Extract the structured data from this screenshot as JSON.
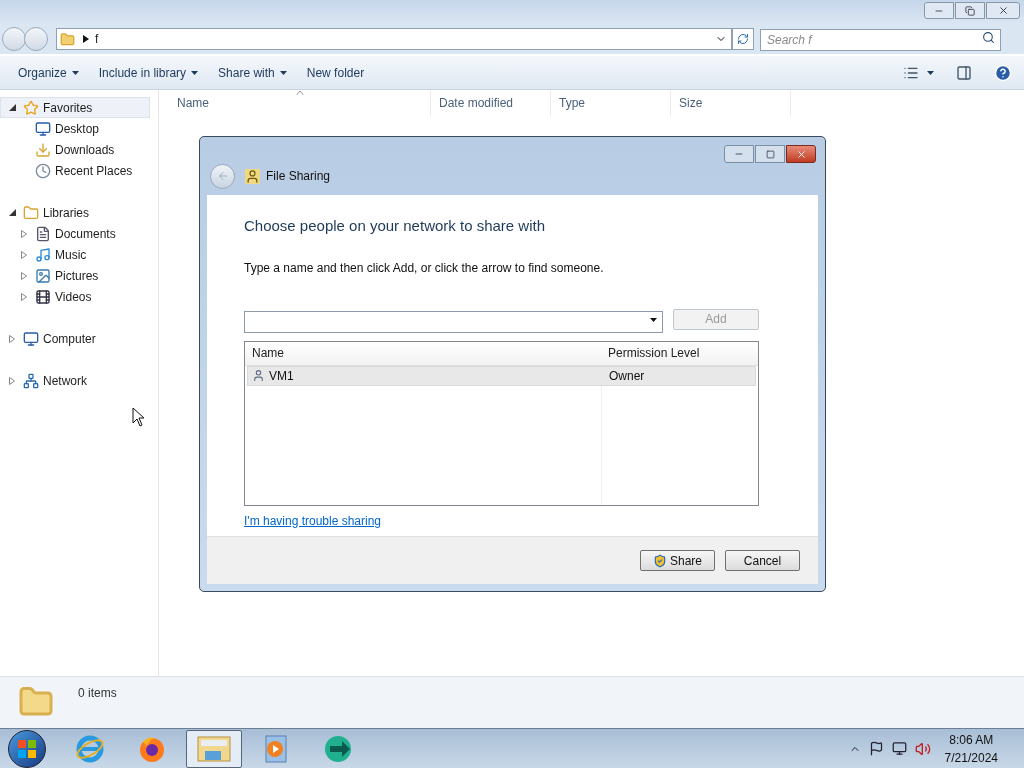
{
  "explorer": {
    "address": {
      "path": "f"
    },
    "search": {
      "placeholder": "Search f"
    },
    "toolbar": [
      {
        "label": "Organize",
        "has_menu": true
      },
      {
        "label": "Include in library",
        "has_menu": true
      },
      {
        "label": "Share with",
        "has_menu": true
      },
      {
        "label": "New folder",
        "has_menu": false
      }
    ],
    "sidebar": [
      {
        "label": "Favorites",
        "expanded": true,
        "selected": true,
        "children": [
          {
            "label": "Desktop",
            "selected": false
          },
          {
            "label": "Downloads",
            "selected": false
          },
          {
            "label": "Recent Places",
            "selected": false
          }
        ]
      },
      {
        "label": "Libraries",
        "expanded": true,
        "selected": false,
        "children": [
          {
            "label": "Documents",
            "expanded": false,
            "selected": false
          },
          {
            "label": "Music",
            "expanded": false,
            "selected": false
          },
          {
            "label": "Pictures",
            "expanded": false,
            "selected": false
          },
          {
            "label": "Videos",
            "expanded": false,
            "selected": false
          }
        ]
      },
      {
        "label": "Computer",
        "expanded": false,
        "selected": false
      },
      {
        "label": "Network",
        "expanded": false,
        "selected": false
      }
    ],
    "columns": [
      {
        "label": "Name",
        "sorted": true
      },
      {
        "label": "Date modified",
        "sorted": false
      },
      {
        "label": "Type",
        "sorted": false
      },
      {
        "label": "Size",
        "sorted": false
      }
    ],
    "status": {
      "count": "0 items"
    }
  },
  "dialog": {
    "title": "File Sharing",
    "heading": "Choose people on your network to share with",
    "instruction": "Type a name and then click Add, or click the arrow to find someone.",
    "add_button": {
      "label": "Add",
      "disabled": true
    },
    "columns": [
      "Name",
      "Permission Level"
    ],
    "rows": [
      {
        "name": "VM1",
        "permission": "Owner",
        "selected": true
      }
    ],
    "link": "I'm having trouble sharing",
    "buttons": [
      {
        "label": "Share",
        "kind": "shield"
      },
      {
        "label": "Cancel",
        "kind": "plain"
      }
    ]
  },
  "taskbar": {
    "apps": [
      {
        "selected": false
      },
      {
        "selected": false
      },
      {
        "selected": true
      },
      {
        "selected": false
      },
      {
        "selected": false
      }
    ],
    "time": "8:06 AM",
    "date": "7/21/2024"
  }
}
